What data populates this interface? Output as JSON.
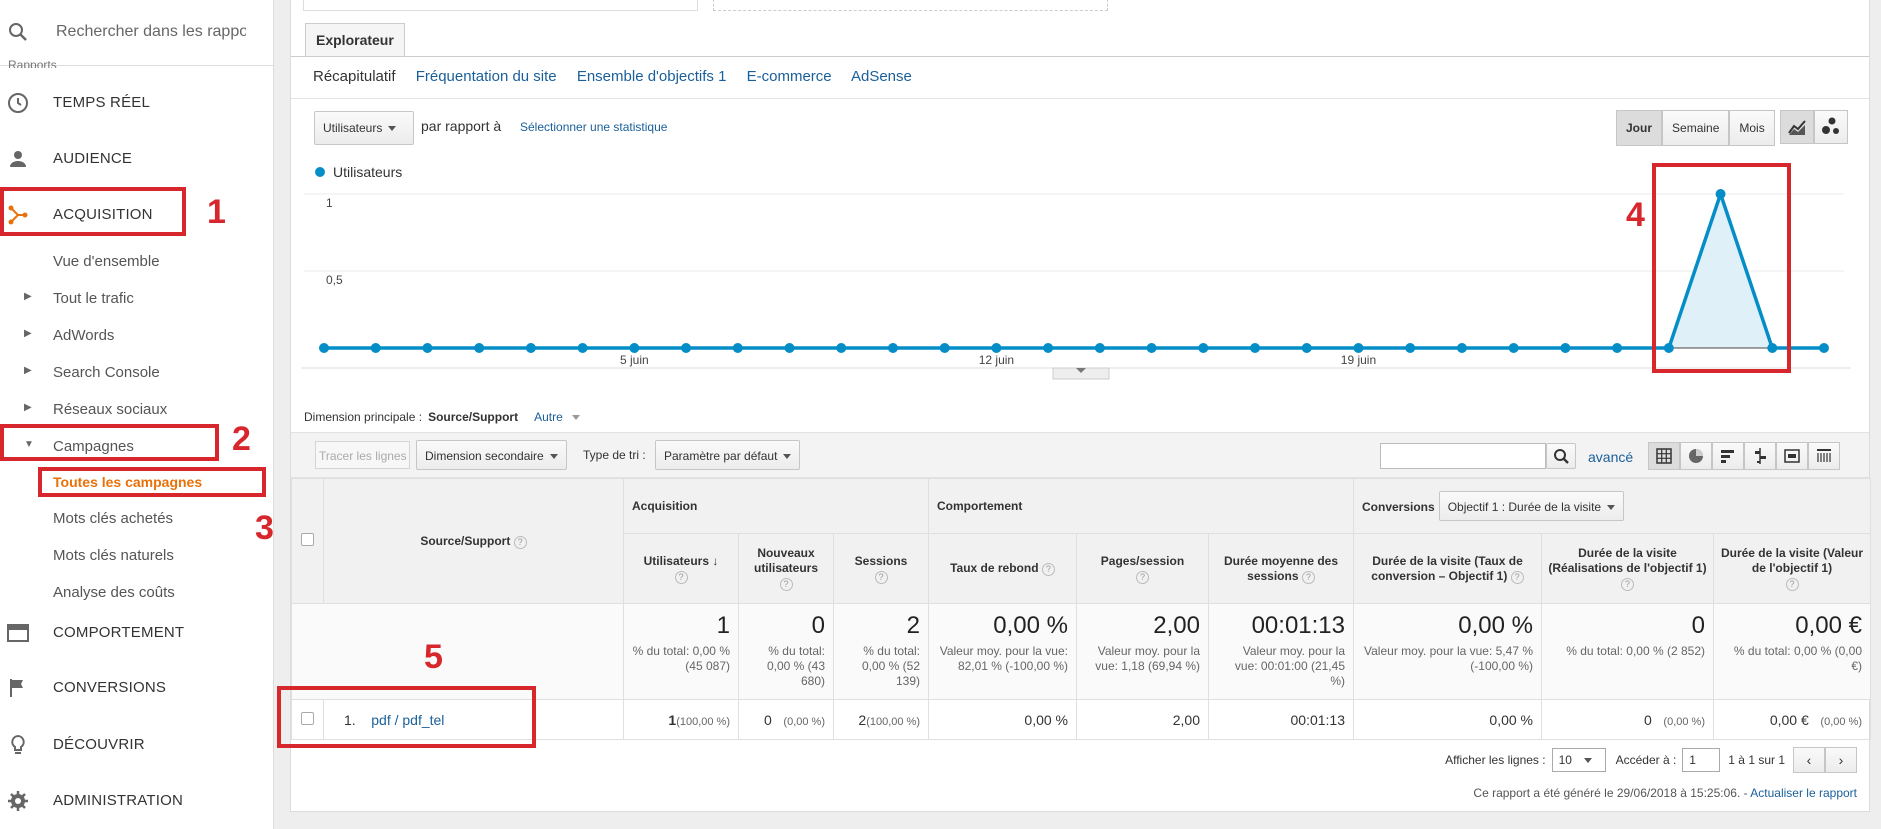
{
  "sidebar": {
    "search_placeholder": "Rechercher dans les rappor",
    "section_cut": "Rapports",
    "items": [
      {
        "label": "TEMPS RÉEL"
      },
      {
        "label": "AUDIENCE"
      },
      {
        "label": "ACQUISITION"
      },
      {
        "label": "COMPORTEMENT"
      },
      {
        "label": "CONVERSIONS"
      },
      {
        "label": "DÉCOUVRIR"
      },
      {
        "label": "ADMINISTRATION"
      }
    ],
    "acquisition_sub": [
      {
        "label": "Vue d'ensemble"
      },
      {
        "label": "Tout le trafic"
      },
      {
        "label": "AdWords"
      },
      {
        "label": "Search Console"
      },
      {
        "label": "Réseaux sociaux"
      },
      {
        "label": "Campagnes"
      },
      {
        "label": "Toutes les campagnes"
      },
      {
        "label": "Mots clés achetés"
      },
      {
        "label": "Mots clés naturels"
      },
      {
        "label": "Analyse des coûts"
      }
    ]
  },
  "explorer": {
    "tab": "Explorateur",
    "subtabs": [
      "Récapitulatif",
      "Fréquentation du site",
      "Ensemble d'objectifs 1",
      "E-commerce",
      "AdSense"
    ]
  },
  "chart_controls": {
    "metric": "Utilisateurs",
    "compare": "par rapport à",
    "select_metric": "Sélectionner une statistique",
    "periods": [
      "Jour",
      "Semaine",
      "Mois"
    ],
    "active_period": "Jour"
  },
  "chart_data": {
    "type": "line",
    "title": "",
    "legend": [
      "Utilisateurs"
    ],
    "series": [
      {
        "name": "Utilisateurs",
        "color": "#058dc7",
        "values": [
          0,
          0,
          0,
          0,
          0,
          0,
          0,
          0,
          0,
          0,
          0,
          0,
          0,
          0,
          0,
          0,
          0,
          0,
          0,
          0,
          0,
          0,
          0,
          0,
          0,
          0,
          0,
          1,
          0,
          0
        ]
      }
    ],
    "x_tick_labels": [
      "5 juin",
      "12 juin",
      "19 juin"
    ],
    "y_tick_labels": [
      "1",
      "0,5"
    ],
    "ylim": [
      0,
      1
    ],
    "highlight_fill_on_spike": true,
    "grid": true
  },
  "table_controls": {
    "primary_dim_label": "Dimension principale :",
    "primary_dim_value": "Source/Support",
    "other": "Autre",
    "plot_rows": "Tracer les lignes",
    "secondary_dim": "Dimension secondaire",
    "sort_label": "Type de tri :",
    "sort_value": "Paramètre par défaut",
    "advanced": "avancé"
  },
  "table": {
    "source_header": "Source/Support",
    "groups": [
      "Acquisition",
      "Comportement",
      "Conversions"
    ],
    "goal_select": "Objectif 1 : Durée de la visite",
    "columns": [
      "Utilisateurs",
      "Nouveaux utilisateurs",
      "Sessions",
      "Taux de rebond",
      "Pages/session",
      "Durée moyenne des sessions",
      "Durée de la visite (Taux de conversion – Objectif 1)",
      "Durée de la visite (Réalisations de l'objectif 1)",
      "Durée de la visite (Valeur de l'objectif 1)"
    ],
    "totals": [
      {
        "value": "1",
        "sub": "% du total: 0,00 % (45 087)"
      },
      {
        "value": "0",
        "sub": "% du total: 0,00 % (43 680)"
      },
      {
        "value": "2",
        "sub": "% du total: 0,00 % (52 139)"
      },
      {
        "value": "0,00 %",
        "sub": "Valeur moy. pour la vue: 82,01 % (-100,00 %)"
      },
      {
        "value": "2,00",
        "sub": "Valeur moy. pour la vue: 1,18 (69,94 %)"
      },
      {
        "value": "00:01:13",
        "sub": "Valeur moy. pour la vue: 00:01:00 (21,45 %)"
      },
      {
        "value": "0,00 %",
        "sub": "Valeur moy. pour la vue: 5,47 % (-100,00 %)"
      },
      {
        "value": "0",
        "sub": "% du total: 0,00 % (2 852)"
      },
      {
        "value": "0,00 €",
        "sub": "% du total: 0,00 % (0,00 €)"
      }
    ],
    "rows": [
      {
        "index": "1.",
        "source": "pdf / pdf_tel",
        "users": "1",
        "users_pct": "(100,00 %)",
        "new_users": "0",
        "new_users_pct": "(0,00 %)",
        "sessions": "2",
        "sessions_pct": "(100,00 %)",
        "bounce": "0,00 %",
        "pages": "2,00",
        "duration": "00:01:13",
        "conv_rate": "0,00 %",
        "completions": "0",
        "completions_pct": "(0,00 %)",
        "goal_value": "0,00 €",
        "goal_value_pct": "(0,00 %)"
      }
    ]
  },
  "pager": {
    "show_rows_label": "Afficher les lignes :",
    "rows_value": "10",
    "goto_label": "Accéder à :",
    "goto_value": "1",
    "range": "1 à 1 sur 1"
  },
  "footer": {
    "generated": "Ce rapport a été généré le 29/06/2018 à 15:25:06. - ",
    "refresh": "Actualiser le rapport"
  },
  "annotations": [
    "1",
    "2",
    "3",
    "4",
    "5"
  ],
  "colors": {
    "annotation": "#d7262c",
    "accent": "#e8710a",
    "series": "#058dc7",
    "link": "#1a5f9a"
  }
}
